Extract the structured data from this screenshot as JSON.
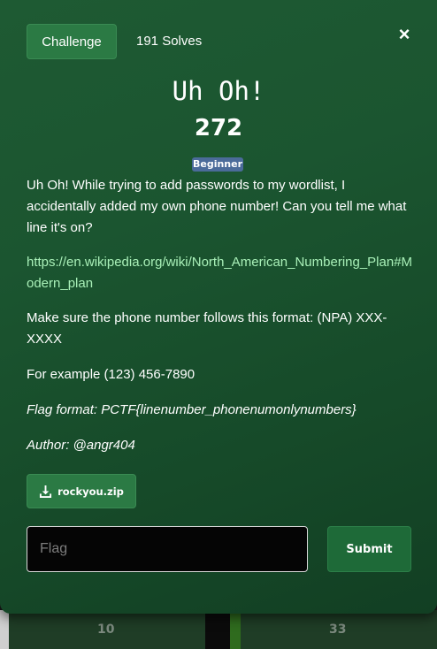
{
  "background": {
    "left_number": "10",
    "right_number": "33"
  },
  "modal": {
    "tab_label": "Challenge",
    "solves": "191 Solves",
    "close_symbol": "×",
    "title": "Uh Oh!",
    "points": "272",
    "tag": "Beginner",
    "description": [
      "Uh Oh! While trying to add passwords to my wordlist, I accidentally added my own phone number! Can you tell me what line it's on?",
      "https://en.wikipedia.org/wiki/North_American_Numbering_Plan#Modern_plan",
      "Make sure the phone number follows this format: (NPA) XXX-XXXX",
      "For example (123) 456-7890",
      "Flag format: PCTF{linenumber_phonenumonlynumbers}",
      "Author: @angr404"
    ],
    "file_button": "rockyou.zip",
    "file_icon": "download-icon",
    "flag_placeholder": "Flag",
    "flag_value": "",
    "submit_label": "Submit"
  },
  "colors": {
    "modal_bg": "#1b5530",
    "button_bg": "#2b7a44",
    "link": "#a9f0b8",
    "tag_bg": "#4b6b9a"
  }
}
